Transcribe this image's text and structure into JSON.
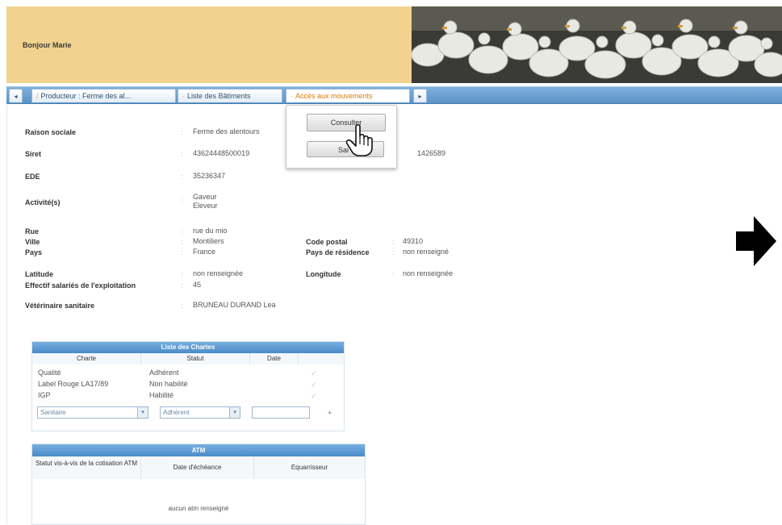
{
  "header": {
    "greeting": "Bonjour Marie"
  },
  "tabs": [
    {
      "label": "Producteur : Ferme des al..."
    },
    {
      "label": "Liste des Bâtiments"
    },
    {
      "label": "Accès aux mouvements"
    }
  ],
  "dropdown": {
    "consult_label": "Consulter",
    "saisir_label": "Saisir"
  },
  "fields": {
    "raison_sociale": {
      "label": "Raison sociale",
      "value": "Ferme des alentours"
    },
    "siret": {
      "label": "Siret",
      "value": "43624448500019",
      "extra": "1426589"
    },
    "ede": {
      "label": "EDE",
      "value": "35236347"
    },
    "activites": {
      "label": "Activité(s)",
      "value1": "Gaveur",
      "value2": "Eleveur"
    },
    "rue": {
      "label": "Rue",
      "value": "rue du mio"
    },
    "ville": {
      "label": "Ville",
      "value": "Montiliers"
    },
    "pays": {
      "label": "Pays",
      "value": "France"
    },
    "code_postal": {
      "label": "Code postal",
      "value": "49310"
    },
    "pays_residence": {
      "label": "Pays de résidence",
      "value": "non renseigné"
    },
    "latitude": {
      "label": "Latitude",
      "value": "non renseignée"
    },
    "longitude": {
      "label": "Longitude",
      "value": "non renseignée"
    },
    "effectif": {
      "label": "Effectif salariés de l'exploitation",
      "value": "45"
    },
    "veterinaire": {
      "label": "Vétérinaire sanitaire",
      "value": "BRUNEAU DURAND Lea"
    }
  },
  "chartes": {
    "title": "Liste des Chartes",
    "columns": [
      "Charte",
      "Statut",
      "Date"
    ],
    "rows": [
      {
        "charte": "Qualité",
        "statut": "Adhérent"
      },
      {
        "charte": "Label Rouge LA17/89",
        "statut": "Non habilité"
      },
      {
        "charte": "IGP",
        "statut": "Habilité"
      }
    ],
    "new_row": {
      "charte": "Sanitaire",
      "statut": "Adhérent",
      "date": ""
    }
  },
  "atm": {
    "title": "ATM",
    "columns": [
      "Statut vis-à-vis de la cotisation ATM",
      "Date d'échéance",
      "Equarrisseur"
    ],
    "empty": "aucun atm renseigné"
  },
  "colors": {
    "banner": "#f1d28e",
    "tabbar": "#5b93c8",
    "active_tab": "#e07a00",
    "panel_head": "#4a8bc8"
  }
}
